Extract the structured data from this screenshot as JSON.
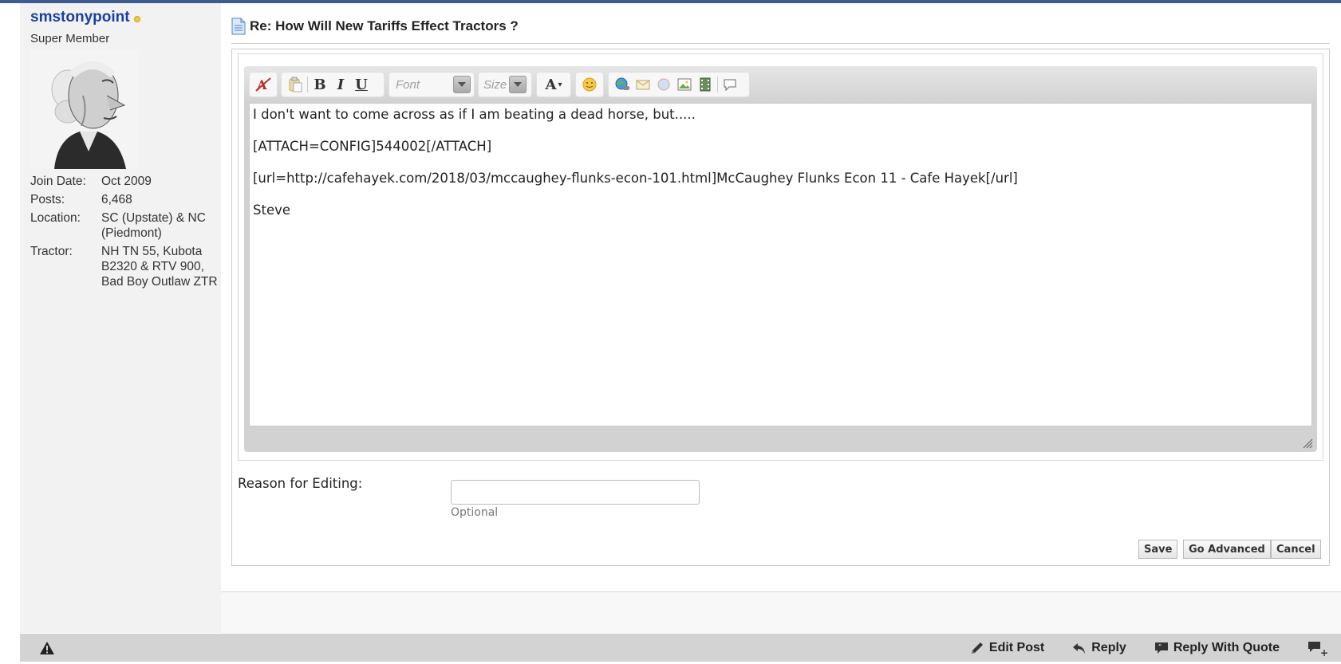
{
  "user": {
    "name": "smstonypoint",
    "title": "Super Member",
    "stats": [
      {
        "label": "Join Date:",
        "value": "Oct 2009"
      },
      {
        "label": "Posts:",
        "value": "6,468"
      },
      {
        "label": "Location:",
        "value": "SC (Upstate) & NC (Piedmont)"
      },
      {
        "label": "Tractor:",
        "value": "NH TN 55, Kubota B2320 & RTV 900, Bad Boy Outlaw ZTR"
      }
    ]
  },
  "post": {
    "title": "Re: How Will New Tariffs Effect Tractors ?"
  },
  "editor": {
    "font_placeholder": "Font",
    "size_placeholder": "Size",
    "lines": [
      "I don't want to come across as if I am beating a dead horse, but.....",
      "[ATTACH=CONFIG]544002[/ATTACH]",
      "[url=http://cafehayek.com/2018/03/mccaughey-flunks-econ-101.html]McCaughey Flunks Econ 11 - Cafe Hayek[/url]",
      "Steve"
    ]
  },
  "reason": {
    "label": "Reason for Editing:",
    "value": "",
    "hint": "Optional"
  },
  "buttons": {
    "save": "Save",
    "advanced": "Go Advanced",
    "cancel": "Cancel"
  },
  "actions": {
    "edit": "Edit Post",
    "reply": "Reply",
    "quote": "Reply With Quote"
  },
  "colors": {
    "accent": "#3e5c92",
    "username": "#1a3fa0",
    "online": "#f3c83d"
  }
}
